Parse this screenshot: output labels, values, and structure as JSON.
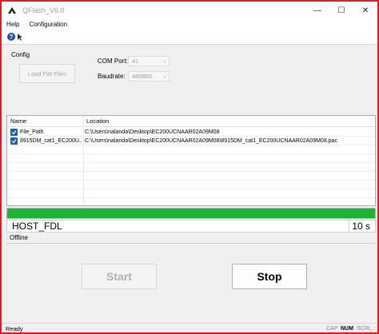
{
  "window": {
    "title": "QFlash_V6.0",
    "controls": {
      "minimize": "—",
      "maximize": "☐",
      "close": "✕"
    }
  },
  "menu": {
    "items": [
      "Help",
      "Configuration"
    ]
  },
  "toolbar": {
    "help_icon": "help-pointer-icon"
  },
  "config": {
    "label": "Config",
    "load_button": "Load FW Files",
    "com_port_label": "COM Port:",
    "com_port_value": "41",
    "baudrate_label": "Baudrate:",
    "baudrate_value": "460800"
  },
  "files": {
    "columns": [
      "Name",
      "Location"
    ],
    "rows": [
      {
        "name": "File_Path",
        "location": "C:\\Users\\nalanda\\Desktop\\EC200UCNAAR02A09M08",
        "checked": true
      },
      {
        "name": "8915DM_cat1_EC200U...",
        "location": "C:\\Users\\nalanda\\Desktop\\EC200UCNAAR02A09M08\\8915DM_cat1_EC200UCNAAR02A09M08.pac",
        "checked": true
      }
    ]
  },
  "progress": {
    "fraction": 1.0,
    "color": "#1db334"
  },
  "status": {
    "stage": "HOST_FDL",
    "elapsed": "10 s",
    "state": "Offline"
  },
  "buttons": {
    "start": "Start",
    "stop": "Stop"
  },
  "statusbar": {
    "ready": "Ready",
    "cap": "CAP",
    "num": "NUM",
    "scrl": "SCRL"
  },
  "colors": {
    "border_accent": "#e01b24",
    "checkbox": "#1e5fb3"
  }
}
